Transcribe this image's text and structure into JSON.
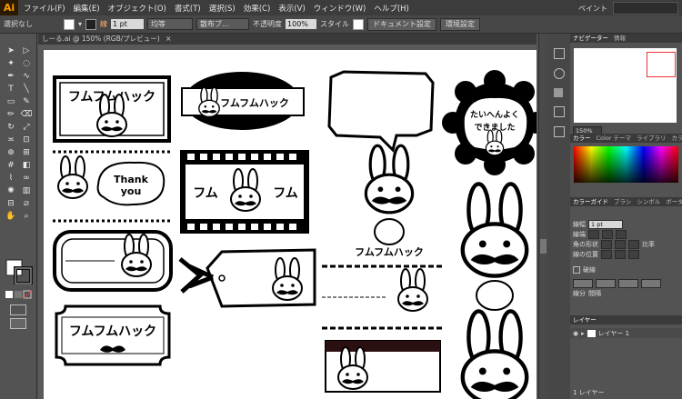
{
  "app": {
    "logo": "Ai"
  },
  "menu": [
    "ファイル(F)",
    "編集(E)",
    "オブジェクト(O)",
    "書式(T)",
    "選択(S)",
    "効果(C)",
    "表示(V)",
    "ウィンドウ(W)",
    "ヘルプ(H)"
  ],
  "menu_right": {
    "workspace": "ペイント"
  },
  "control": {
    "selection": "選択なし",
    "stroke_label": "線",
    "stroke_width": "1 pt",
    "profile": "均等",
    "brush": "散布ブ...",
    "opacity_label": "不透明度",
    "opacity": "100%",
    "style_label": "スタイル",
    "doc_setup": "ドキュメント設定",
    "preferences": "環境設定"
  },
  "document_tab": "しーる.ai @ 150% (RGB/プレビュー)",
  "navigator": {
    "tabs": [
      "ナビゲーター",
      "情報"
    ],
    "zoom": "150%"
  },
  "color": {
    "tabs": [
      "カラー",
      "Color テーマ",
      "ライブラリ",
      "カラーガ"
    ]
  },
  "stroke_panel": {
    "tabs": [
      "カラーガイド",
      "ブラシ",
      "シンボル",
      "ボーダーライ"
    ],
    "weight_label": "線幅",
    "weight": "1 pt",
    "cap_label": "線端",
    "corner_label": "角の形状",
    "limit_label": "比率",
    "align_label": "線の位置",
    "dash_label": "破線",
    "dash_field": "線分",
    "gap_field": "間隔"
  },
  "layers": {
    "tab": "レイヤー",
    "layer_name": "レイヤー 1",
    "footer": "1 レイヤー"
  },
  "artwork": {
    "label_1": "フムフムハック",
    "label_2": "フムフムハック",
    "label_3a": "フム",
    "label_3b": "フム",
    "thank_you": "Thank\nyou",
    "taihen": "たいへんよく",
    "dekimashita": "できました",
    "rabbit_caption": "フムフムハック",
    "label_banner": "フムフムハック"
  }
}
